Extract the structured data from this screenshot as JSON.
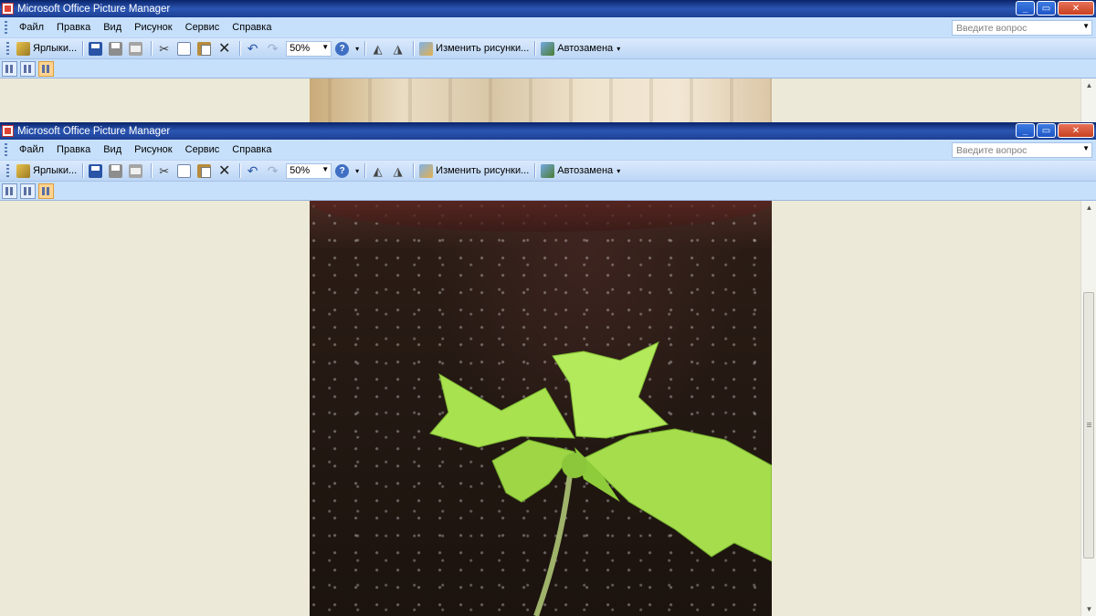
{
  "windows": [
    {
      "title": "Microsoft Office Picture Manager",
      "controls": {
        "minimize": "_",
        "restore": "▭",
        "close": "✕"
      },
      "menu": [
        {
          "label": "Файл"
        },
        {
          "label": "Правка"
        },
        {
          "label": "Вид"
        },
        {
          "label": "Рисунок"
        },
        {
          "label": "Сервис"
        },
        {
          "label": "Справка"
        }
      ],
      "help_placeholder": "Введите вопрос",
      "toolbar": {
        "shortcuts_label": "Ярлыки...",
        "zoom_value": "50%",
        "edit_label": "Изменить рисунки...",
        "autocorrect_label": "Автозамена"
      }
    },
    {
      "title": "Microsoft Office Picture Manager",
      "controls": {
        "minimize": "_",
        "restore": "▭",
        "close": "✕"
      },
      "menu": [
        {
          "label": "Файл"
        },
        {
          "label": "Правка"
        },
        {
          "label": "Вид"
        },
        {
          "label": "Рисунок"
        },
        {
          "label": "Сервис"
        },
        {
          "label": "Справка"
        }
      ],
      "help_placeholder": "Введите вопрос",
      "toolbar": {
        "shortcuts_label": "Ярлыки...",
        "zoom_value": "50%",
        "edit_label": "Изменить рисунки...",
        "autocorrect_label": "Автозамена"
      }
    }
  ],
  "icons": {
    "shortcuts": "shortcuts-icon",
    "save": "save-icon",
    "print": "print-icon",
    "email": "email-icon",
    "cut": "cut-icon",
    "copy": "copy-icon",
    "paste": "paste-icon",
    "delete": "delete-icon",
    "undo": "undo-icon",
    "redo": "redo-icon",
    "help": "help-icon",
    "rotate_left": "rotate-left-icon",
    "rotate_right": "rotate-right-icon",
    "edit": "edit-pictures-icon",
    "autocorrect": "auto-correct-icon"
  },
  "colors": {
    "titlebar": "#0a246a",
    "menubar": "#c6e0fb",
    "workspace": "#ece9d8",
    "leaf": "#9ee04a",
    "soil": "#231812"
  },
  "pictures": {
    "top": "wallpaper",
    "bottom": "seedling in soil"
  }
}
